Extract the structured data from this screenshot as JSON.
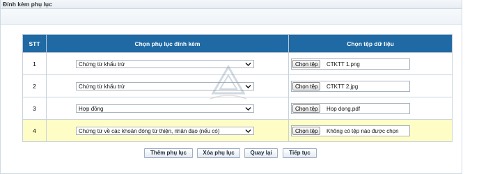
{
  "panel": {
    "title": "Đính kèm phụ lục"
  },
  "table": {
    "headers": {
      "stt": "STT",
      "appendix": "Chọn phụ lục đính kèm",
      "file": "Chọn tệp dữ liệu"
    },
    "rows": [
      {
        "stt": "1",
        "appendix": "Chứng từ khấu trừ",
        "button": "Chọn tệp",
        "file": "CTKTT 1.png"
      },
      {
        "stt": "2",
        "appendix": "Chứng từ khấu trừ",
        "button": "Chọn tệp",
        "file": "CTKTT 2.jpg"
      },
      {
        "stt": "3",
        "appendix": "Hợp đồng",
        "button": "Chọn tệp",
        "file": "Hop dong.pdf"
      },
      {
        "stt": "4",
        "appendix": "Chứng từ về các khoản đóng từ thiện, nhân đạo (nếu có)",
        "button": "Chọn tệp",
        "file": "Không có tệp nào được chọn"
      }
    ]
  },
  "actions": {
    "add": "Thêm phụ lục",
    "delete": "Xóa phụ lục",
    "back": "Quay lại",
    "next": "Tiếp tục"
  },
  "colors": {
    "header_bg": "#1f6aa4",
    "highlight_row": "#fffdc6"
  },
  "watermark": {
    "icon": "triangle-logo-watermark"
  }
}
